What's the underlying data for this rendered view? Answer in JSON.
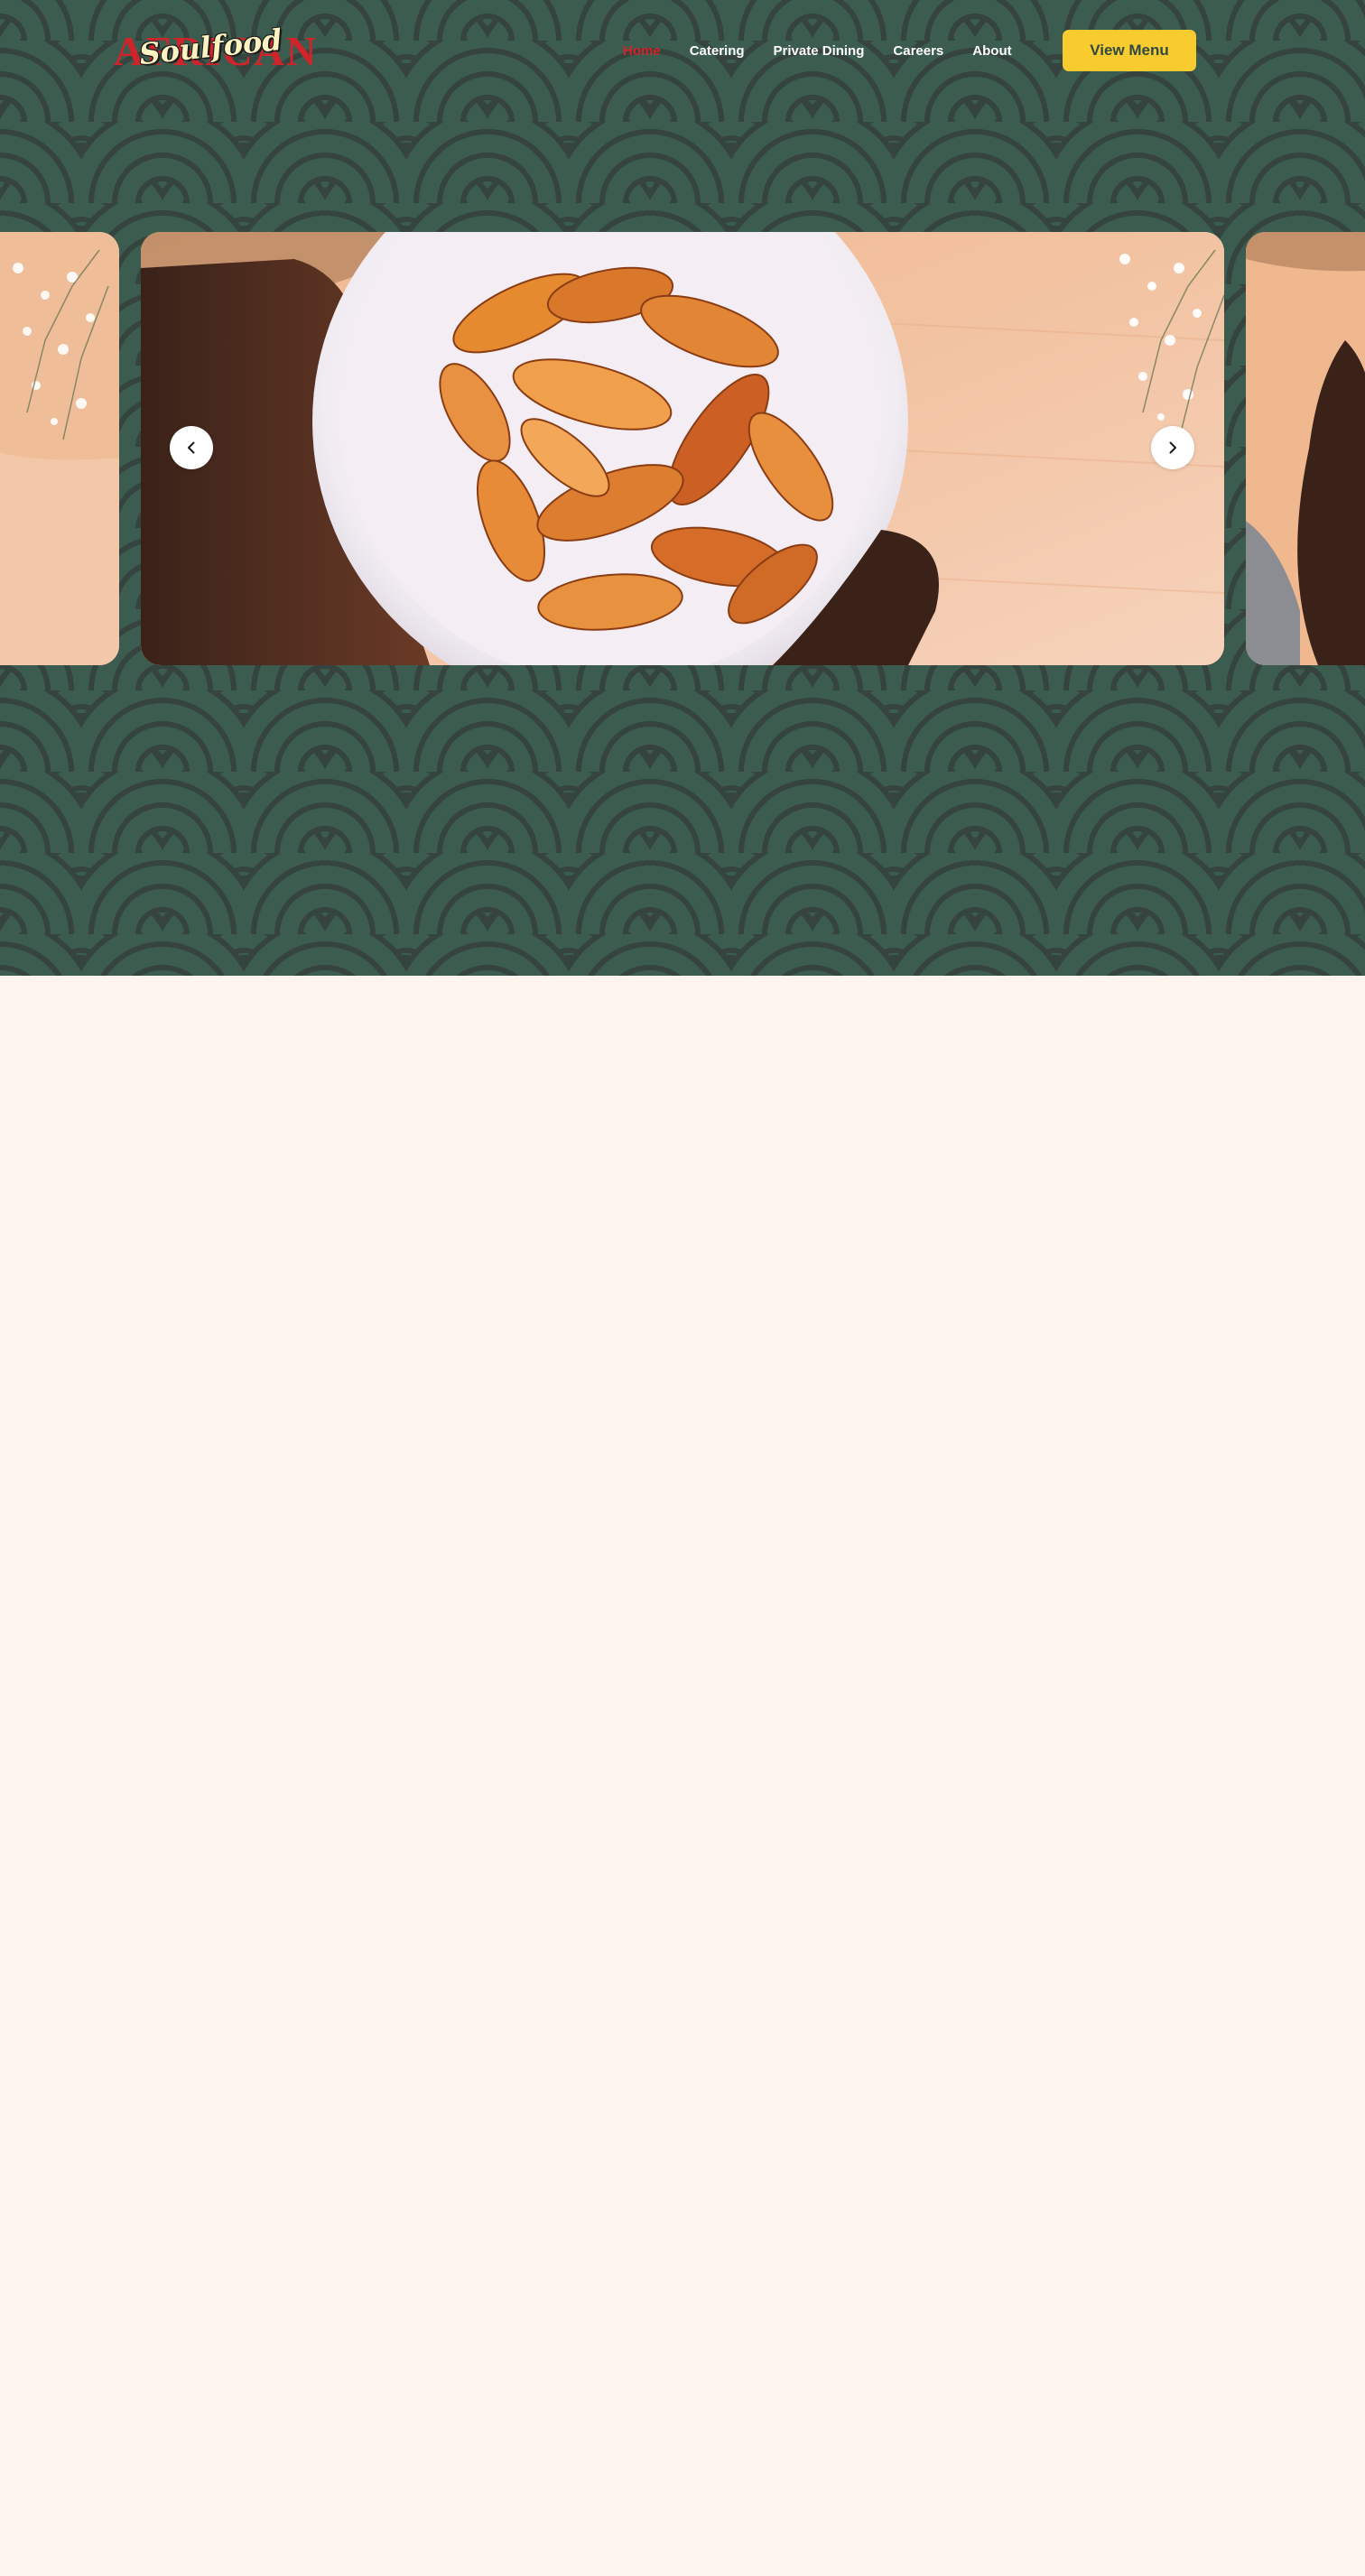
{
  "brand": {
    "logo_back_text": "AFRICAN",
    "logo_front_text": "Soulfood",
    "red": "#d1242a",
    "green": "#3c5c50",
    "yellow": "#f8cb2e",
    "cream": "#fdf4ee"
  },
  "nav": {
    "items": [
      {
        "label": "Home",
        "active": true
      },
      {
        "label": "Catering",
        "active": false
      },
      {
        "label": "Private Dining",
        "active": false
      },
      {
        "label": "Careers",
        "active": false
      },
      {
        "label": "About",
        "active": false
      }
    ],
    "cta_label": "View Menu"
  },
  "carousel": {
    "prev_icon": "chevron-left-icon",
    "next_icon": "chevron-right-icon",
    "image_subject": "fried plantains"
  }
}
